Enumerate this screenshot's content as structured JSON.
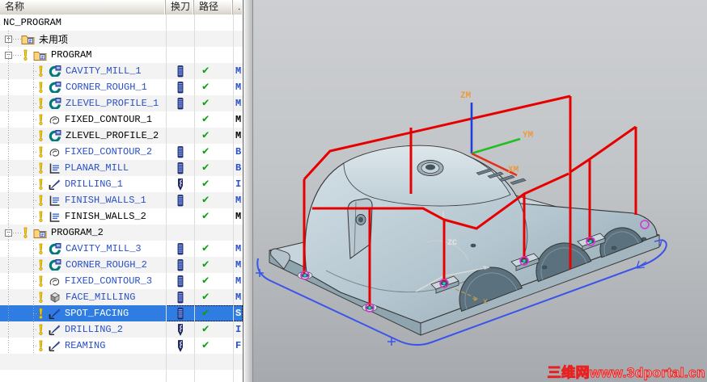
{
  "tree": {
    "columns": [
      "名称",
      "换刀",
      "路径",
      "."
    ],
    "check_glyph": "✔",
    "rows": [
      {
        "label": "NC_PROGRAM",
        "kind": "root"
      },
      {
        "label": "未用项",
        "kind": "group",
        "expand": "+",
        "alert": false
      },
      {
        "label": "PROGRAM",
        "kind": "group",
        "expand": "−",
        "alert": true
      },
      {
        "label": "CAVITY_MILL_1",
        "kind": "op",
        "op_icon": "mill-icon",
        "tool_icon": "endmill-tool-icon",
        "path_ok": true,
        "tool_letter": "M",
        "link": true
      },
      {
        "label": "CORNER_ROUGH_1",
        "kind": "op",
        "op_icon": "mill-icon",
        "tool_icon": "endmill-tool-icon",
        "path_ok": true,
        "tool_letter": "M",
        "link": true
      },
      {
        "label": "ZLEVEL_PROFILE_1",
        "kind": "op",
        "op_icon": "mill-icon",
        "tool_icon": "endmill-tool-icon",
        "path_ok": true,
        "tool_letter": "M",
        "link": true
      },
      {
        "label": "FIXED_CONTOUR_1",
        "kind": "op",
        "op_icon": "contour-icon",
        "tool_icon": null,
        "path_ok": true,
        "tool_letter": "M",
        "link": false
      },
      {
        "label": "ZLEVEL_PROFILE_2",
        "kind": "op",
        "op_icon": "mill-icon",
        "tool_icon": null,
        "path_ok": true,
        "tool_letter": "M",
        "link": false
      },
      {
        "label": "FIXED_CONTOUR_2",
        "kind": "op",
        "op_icon": "contour-icon",
        "tool_icon": "endmill-tool-icon",
        "path_ok": true,
        "tool_letter": "B",
        "link": true
      },
      {
        "label": "PLANAR_MILL",
        "kind": "op",
        "op_icon": "planar-icon",
        "tool_icon": "endmill-tool-icon",
        "path_ok": true,
        "tool_letter": "B",
        "link": true
      },
      {
        "label": "DRILLING_1",
        "kind": "op",
        "op_icon": "drillop-icon",
        "tool_icon": "drill-tool-icon",
        "path_ok": true,
        "tool_letter": "I",
        "link": true
      },
      {
        "label": "FINISH_WALLS_1",
        "kind": "op",
        "op_icon": "planar-icon",
        "tool_icon": "endmill-tool-icon",
        "path_ok": true,
        "tool_letter": "M",
        "link": true
      },
      {
        "label": "FINISH_WALLS_2",
        "kind": "op",
        "op_icon": "planar-icon",
        "tool_icon": null,
        "path_ok": true,
        "tool_letter": "M",
        "link": false
      },
      {
        "label": "PROGRAM_2",
        "kind": "group",
        "expand": "−",
        "alert": true
      },
      {
        "label": "CAVITY_MILL_3",
        "kind": "op",
        "op_icon": "mill-icon",
        "tool_icon": "endmill-tool-icon",
        "path_ok": true,
        "tool_letter": "M",
        "link": true
      },
      {
        "label": "CORNER_ROUGH_2",
        "kind": "op",
        "op_icon": "mill-icon",
        "tool_icon": "endmill-tool-icon",
        "path_ok": true,
        "tool_letter": "M",
        "link": true
      },
      {
        "label": "FIXED_CONTOUR_3",
        "kind": "op",
        "op_icon": "contour-icon",
        "tool_icon": "endmill-tool-icon",
        "path_ok": true,
        "tool_letter": "M",
        "link": true
      },
      {
        "label": "FACE_MILLING",
        "kind": "op",
        "op_icon": "facemill-icon",
        "tool_icon": "endmill-tool-icon",
        "path_ok": true,
        "tool_letter": "M",
        "link": true
      },
      {
        "label": "SPOT_FACING",
        "kind": "op",
        "op_icon": "drillop-icon",
        "tool_icon": "endmill-tool-icon",
        "path_ok": true,
        "tool_letter": "S",
        "link": true,
        "selected": true
      },
      {
        "label": "DRILLING_2",
        "kind": "op",
        "op_icon": "drillop-icon",
        "tool_icon": "drill-tool-icon",
        "path_ok": true,
        "tool_letter": "I",
        "link": true
      },
      {
        "label": "REAMING",
        "kind": "op",
        "op_icon": "drillop-icon",
        "tool_icon": "drill-tool-icon",
        "path_ok": true,
        "tool_letter": "F",
        "link": true
      }
    ]
  },
  "viewport": {
    "axes_mcs": {
      "z": "ZM",
      "y": "YM",
      "x": "XM"
    },
    "axes_wcs": {
      "z": "ZC",
      "x": "x"
    },
    "watermark": "三维网www.3dportal.cn",
    "colors": {
      "toolpath": "#e60000",
      "boundary": "#3a55e8",
      "drill_marker": "#d633d6",
      "marker_center": "#00e5e5",
      "axis_z": "#1f3fd8",
      "axis_y": "#1fc01f",
      "axis_x": "#e03020",
      "axis_label": "#eb9a3d"
    }
  }
}
